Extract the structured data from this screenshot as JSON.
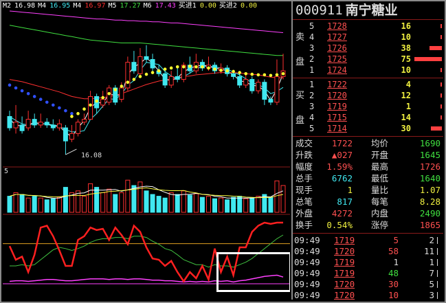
{
  "colors": {
    "up": "#ff3030",
    "down": "#40e8f0",
    "ma2": "#ffffff",
    "ma4": "#ff3030",
    "ma5": "#40e040",
    "ma6": "#ff40ff",
    "label_yellow": "#f0f040",
    "label_red": "#ff5050",
    "label_green": "#40e040",
    "label_cyan": "#40e8f0"
  },
  "ma_bar": {
    "items": [
      {
        "name": "M2",
        "value": "16.98",
        "color": "#ffffff"
      },
      {
        "name": "M4",
        "value": "16.95",
        "color": "#40e8f0"
      },
      {
        "name": "M4",
        "value": "16.97",
        "color": "#ff3030"
      },
      {
        "name": "M5",
        "value": "17.27",
        "color": "#40e040"
      },
      {
        "name": "M6",
        "value": "17.43",
        "color": "#ff40ff"
      },
      {
        "name": "买进1",
        "value": "0.00",
        "color": "#f0f040"
      },
      {
        "name": "买进2",
        "value": "0.00",
        "color": "#f0f040"
      }
    ]
  },
  "chart_labels": {
    "low_price": "16.08",
    "volume_scale": "5"
  },
  "header": {
    "code": "000911",
    "name": "南宁糖业"
  },
  "sell_side_label": [
    "卖",
    "盘"
  ],
  "buy_side_label": [
    "买",
    "盘"
  ],
  "sell_book": [
    {
      "level": "5",
      "price": "1728",
      "volume": "16",
      "bar": 0.05
    },
    {
      "level": "4",
      "price": "1727",
      "volume": "10",
      "bar": 0.03
    },
    {
      "level": "3",
      "price": "1726",
      "volume": "38",
      "bar": 0.45
    },
    {
      "level": "2",
      "price": "1725",
      "volume": "75",
      "bar": 1.0
    },
    {
      "level": "1",
      "price": "1724",
      "volume": "10",
      "bar": 0.03
    }
  ],
  "buy_book": [
    {
      "level": "1",
      "price": "1722",
      "volume": "4",
      "bar": 0.02
    },
    {
      "level": "2",
      "price": "1720",
      "volume": "12",
      "bar": 0.05
    },
    {
      "level": "3",
      "price": "1719",
      "volume": "1",
      "bar": 0.01
    },
    {
      "level": "4",
      "price": "1715",
      "volume": "14",
      "bar": 0.05
    },
    {
      "level": "5",
      "price": "1714",
      "volume": "30",
      "bar": 0.4
    }
  ],
  "stats": [
    {
      "label": "成交",
      "value": "1722",
      "label2": "均价",
      "value2": "1690",
      "c1": "#ff5050",
      "c2": "#40e040"
    },
    {
      "label": "升跌",
      "value": "▲027",
      "label2": "开盘",
      "value2": "1645",
      "c1": "#ff5050",
      "c2": "#40e040"
    },
    {
      "label": "幅度",
      "value": "1.59%",
      "label2": "最高",
      "value2": "1726",
      "c1": "#ff5050",
      "c2": "#ff5050"
    },
    {
      "label": "总手",
      "value": "6762",
      "label2": "最低",
      "value2": "1640",
      "c1": "#40e8f0",
      "c2": "#40e040"
    },
    {
      "label": "现手",
      "value": "1",
      "label2": "量比",
      "value2": "1.07",
      "c1": "#f0f040",
      "c2": "#f0f040"
    },
    {
      "label": "总笔",
      "value": "817",
      "label2": "每笔",
      "value2": "8.28",
      "c1": "#40e8f0",
      "c2": "#f0f040"
    },
    {
      "label": "外盘",
      "value": "4272",
      "label2": "内盘",
      "value2": "2490",
      "c1": "#ff5050",
      "c2": "#40e040"
    },
    {
      "label": "换手",
      "value": "0.54%",
      "label2": "涨停",
      "value2": "1865",
      "c1": "#f0f040",
      "c2": "#ff5050"
    }
  ],
  "trades": [
    {
      "time": "09:49",
      "price": "1719",
      "volume": "5",
      "count": "2",
      "color": "#ff5050"
    },
    {
      "time": "09:49",
      "price": "1720",
      "volume": "58",
      "count": "11",
      "color": "#ff5050"
    },
    {
      "time": "09:49",
      "price": "1719",
      "volume": "1",
      "count": "1",
      "color": "#ddd"
    },
    {
      "time": "09:49",
      "price": "1719",
      "volume": "48",
      "count": "7",
      "color": "#40e040"
    },
    {
      "time": "09:49",
      "price": "1720",
      "volume": "30",
      "count": "5",
      "color": "#ff5050"
    },
    {
      "time": "09:49",
      "price": "1720",
      "volume": "10",
      "count": "3",
      "color": "#ff5050"
    }
  ],
  "chart_data": {
    "type": "candlestick",
    "price_panel": {
      "ylim": [
        15.9,
        18.6
      ],
      "candles": [
        {
          "o": 16.75,
          "c": 16.55,
          "h": 16.85,
          "l": 16.5
        },
        {
          "o": 16.55,
          "c": 16.65,
          "h": 16.95,
          "l": 16.45
        },
        {
          "o": 16.6,
          "c": 16.5,
          "h": 16.75,
          "l": 16.45
        },
        {
          "o": 16.55,
          "c": 16.7,
          "h": 16.85,
          "l": 16.5
        },
        {
          "o": 16.7,
          "c": 16.6,
          "h": 16.8,
          "l": 16.55
        },
        {
          "o": 16.6,
          "c": 16.65,
          "h": 16.8,
          "l": 16.55
        },
        {
          "o": 16.65,
          "c": 16.6,
          "h": 16.72,
          "l": 16.55
        },
        {
          "o": 16.6,
          "c": 16.55,
          "h": 16.7,
          "l": 16.5
        },
        {
          "o": 16.55,
          "c": 16.62,
          "h": 16.7,
          "l": 16.5
        },
        {
          "o": 16.55,
          "c": 16.32,
          "h": 16.6,
          "l": 16.08
        },
        {
          "o": 16.35,
          "c": 16.45,
          "h": 16.6,
          "l": 16.3
        },
        {
          "o": 16.45,
          "c": 16.65,
          "h": 16.7,
          "l": 16.4
        },
        {
          "o": 16.65,
          "c": 16.7,
          "h": 16.8,
          "l": 16.6
        },
        {
          "o": 16.7,
          "c": 17.1,
          "h": 17.2,
          "l": 16.7
        },
        {
          "o": 17.1,
          "c": 16.9,
          "h": 17.15,
          "l": 16.8
        },
        {
          "o": 16.95,
          "c": 17.05,
          "h": 17.2,
          "l": 16.9
        },
        {
          "o": 17.0,
          "c": 17.25,
          "h": 17.3,
          "l": 16.95
        },
        {
          "o": 17.25,
          "c": 17.0,
          "h": 17.3,
          "l": 16.95
        },
        {
          "o": 17.05,
          "c": 17.25,
          "h": 17.35,
          "l": 17.0
        },
        {
          "o": 17.25,
          "c": 17.7,
          "h": 17.8,
          "l": 17.2
        },
        {
          "o": 17.7,
          "c": 17.55,
          "h": 17.9,
          "l": 17.5
        },
        {
          "o": 17.5,
          "c": 17.8,
          "h": 17.95,
          "l": 17.45
        },
        {
          "o": 17.8,
          "c": 17.75,
          "h": 18.0,
          "l": 17.7
        },
        {
          "o": 17.75,
          "c": 17.6,
          "h": 17.85,
          "l": 17.55
        },
        {
          "o": 17.55,
          "c": 17.5,
          "h": 17.65,
          "l": 17.45
        },
        {
          "o": 17.5,
          "c": 17.3,
          "h": 17.55,
          "l": 17.25
        },
        {
          "o": 17.3,
          "c": 17.45,
          "h": 17.55,
          "l": 17.25
        },
        {
          "o": 17.45,
          "c": 17.4,
          "h": 17.6,
          "l": 17.35
        },
        {
          "o": 17.4,
          "c": 17.65,
          "h": 17.7,
          "l": 17.35
        },
        {
          "o": 17.65,
          "c": 17.55,
          "h": 17.8,
          "l": 17.5
        },
        {
          "o": 17.55,
          "c": 17.7,
          "h": 17.85,
          "l": 17.5
        },
        {
          "o": 17.7,
          "c": 17.6,
          "h": 17.75,
          "l": 17.55
        },
        {
          "o": 17.6,
          "c": 17.65,
          "h": 17.8,
          "l": 17.55
        },
        {
          "o": 17.65,
          "c": 17.55,
          "h": 17.7,
          "l": 17.5
        },
        {
          "o": 17.55,
          "c": 17.6,
          "h": 17.68,
          "l": 17.5
        },
        {
          "o": 17.6,
          "c": 17.5,
          "h": 17.65,
          "l": 17.45
        },
        {
          "o": 17.5,
          "c": 17.45,
          "h": 17.55,
          "l": 17.4
        },
        {
          "o": 17.45,
          "c": 17.3,
          "h": 17.5,
          "l": 17.25
        },
        {
          "o": 17.3,
          "c": 17.4,
          "h": 17.5,
          "l": 17.25
        },
        {
          "o": 17.4,
          "c": 17.2,
          "h": 17.45,
          "l": 17.15
        },
        {
          "o": 17.2,
          "c": 17.35,
          "h": 17.4,
          "l": 17.15
        },
        {
          "o": 17.35,
          "c": 17.05,
          "h": 17.4,
          "l": 16.95
        },
        {
          "o": 17.05,
          "c": 17.0,
          "h": 17.1,
          "l": 16.95
        },
        {
          "o": 17.0,
          "c": 17.45,
          "h": 17.75,
          "l": 16.95
        },
        {
          "o": 17.45,
          "c": 17.55,
          "h": 17.85,
          "l": 17.4
        }
      ],
      "ma_lines": [
        {
          "name": "M2",
          "color": "#ffffff",
          "values": [
            16.7,
            16.6,
            16.58,
            16.6,
            16.65,
            16.62,
            16.62,
            16.58,
            16.58,
            16.47,
            16.39,
            16.55,
            16.68,
            16.9,
            17.0,
            16.98,
            17.15,
            17.12,
            17.13,
            17.48,
            17.62,
            17.68,
            17.78,
            17.68,
            17.55,
            17.4,
            17.38,
            17.43,
            17.53,
            17.6,
            17.63,
            17.65,
            17.63,
            17.6,
            17.58,
            17.55,
            17.48,
            17.38,
            17.35,
            17.3,
            17.28,
            17.2,
            17.03,
            17.23,
            17.5
          ]
        },
        {
          "name": "M4",
          "color": "#40e8f0",
          "values": [
            16.75,
            16.68,
            16.62,
            16.6,
            16.62,
            16.62,
            16.62,
            16.6,
            16.58,
            16.52,
            16.48,
            16.48,
            16.5,
            16.7,
            16.8,
            16.93,
            17.06,
            17.05,
            17.14,
            17.3,
            17.38,
            17.56,
            17.7,
            17.68,
            17.66,
            17.54,
            17.46,
            17.41,
            17.45,
            17.51,
            17.58,
            17.63,
            17.63,
            17.62,
            17.6,
            17.58,
            17.53,
            17.48,
            17.41,
            17.34,
            17.31,
            17.25,
            17.15,
            17.19,
            17.26
          ]
        },
        {
          "name": "M4b",
          "color": "#ff3030",
          "values": [
            17.4,
            17.38,
            17.36,
            17.33,
            17.3,
            17.27,
            17.24,
            17.21,
            17.18,
            17.14,
            17.1,
            17.08,
            17.06,
            17.06,
            17.07,
            17.08,
            17.1,
            17.12,
            17.15,
            17.19,
            17.23,
            17.27,
            17.31,
            17.34,
            17.37,
            17.39,
            17.41,
            17.43,
            17.45,
            17.46,
            17.48,
            17.49,
            17.5,
            17.51,
            17.52,
            17.52,
            17.52,
            17.51,
            17.5,
            17.49,
            17.48,
            17.46,
            17.44,
            17.43,
            17.43
          ]
        },
        {
          "name": "M5",
          "color": "#40e040",
          "values": [
            18.35,
            18.33,
            18.31,
            18.29,
            18.27,
            18.25,
            18.23,
            18.21,
            18.19,
            18.17,
            18.15,
            18.13,
            18.11,
            18.09,
            18.08,
            18.07,
            18.06,
            18.05,
            18.04,
            18.04,
            18.04,
            18.04,
            18.03,
            18.02,
            18.01,
            18.0,
            17.99,
            17.98,
            17.97,
            17.96,
            17.95,
            17.94,
            17.93,
            17.92,
            17.91,
            17.9,
            17.89,
            17.88,
            17.87,
            17.86,
            17.85,
            17.84,
            17.83,
            17.82,
            17.82
          ]
        },
        {
          "name": "M6",
          "color": "#ff40ff",
          "values": [
            18.6,
            18.59,
            18.58,
            18.57,
            18.56,
            18.55,
            18.54,
            18.53,
            18.52,
            18.51,
            18.5,
            18.49,
            18.48,
            18.47,
            18.46,
            18.46,
            18.45,
            18.44,
            18.44,
            18.43,
            18.43,
            18.42,
            18.42,
            18.41,
            18.41,
            18.4,
            18.39,
            18.39,
            18.38,
            18.37,
            18.36,
            18.35,
            18.34,
            18.33,
            18.32,
            18.31,
            18.3,
            18.29,
            18.28,
            18.27,
            18.26,
            18.25,
            18.24,
            18.23,
            18.22
          ]
        }
      ],
      "blue_dots": [
        17.3,
        17.25,
        17.2,
        17.15,
        17.1,
        17.05,
        17.0,
        16.95,
        16.9,
        16.85,
        16.8
      ],
      "yellow_dots": [
        16.75,
        16.8,
        16.88,
        16.95,
        17.02,
        17.08,
        17.15,
        17.22,
        17.28,
        17.35,
        17.4,
        17.45,
        17.49,
        17.52,
        17.55,
        17.58,
        17.6,
        17.62,
        17.62,
        17.63,
        17.62,
        17.62,
        17.6,
        17.58,
        17.56,
        17.55,
        17.54,
        17.52,
        17.5,
        17.49,
        17.48,
        17.48,
        17.47,
        17.48,
        17.5
      ]
    },
    "volume_panel": {
      "ylim": [
        0,
        1
      ],
      "values": [
        0.45,
        0.55,
        0.5,
        0.4,
        0.45,
        0.4,
        0.35,
        0.38,
        0.42,
        0.7,
        0.55,
        0.6,
        0.45,
        0.8,
        0.7,
        0.55,
        0.65,
        0.5,
        0.55,
        0.9,
        0.75,
        0.85,
        0.6,
        0.5,
        0.45,
        0.4,
        0.55,
        0.5,
        0.6,
        0.48,
        0.52,
        0.42,
        0.45,
        0.38,
        0.4,
        0.35,
        0.42,
        0.45,
        0.38,
        0.4,
        0.45,
        0.5,
        0.42,
        0.88,
        0.75
      ]
    },
    "indicator_panel": {
      "ylim": [
        0,
        100
      ],
      "red_line": [
        62,
        40,
        45,
        20,
        48,
        92,
        95,
        78,
        55,
        30,
        30,
        72,
        78,
        92,
        88,
        90,
        72,
        92,
        80,
        65,
        95,
        85,
        60,
        42,
        40,
        30,
        38,
        20,
        5,
        20,
        10,
        30,
        8,
        58,
        20,
        45,
        15,
        60,
        60,
        85,
        95,
        100,
        98,
        100,
        100
      ],
      "green_line": [
        30,
        30,
        32,
        30,
        32,
        40,
        48,
        56,
        60,
        58,
        55,
        58,
        62,
        68,
        72,
        74,
        74,
        76,
        76,
        74,
        78,
        78,
        76,
        70,
        65,
        58,
        55,
        48,
        40,
        36,
        32,
        32,
        28,
        32,
        30,
        30,
        28,
        32,
        36,
        42,
        50,
        58,
        66,
        74,
        80
      ],
      "magenta_line": [
        5,
        6,
        6,
        5,
        6,
        7,
        8,
        8,
        7,
        6,
        6,
        7,
        8,
        9,
        9,
        9,
        8,
        9,
        9,
        8,
        9,
        9,
        8,
        7,
        7,
        6,
        6,
        5,
        4,
        5,
        4,
        5,
        4,
        6,
        5,
        6,
        4,
        6,
        7,
        9,
        11,
        13,
        14,
        15,
        12
      ],
      "orange_ref": 66
    }
  }
}
